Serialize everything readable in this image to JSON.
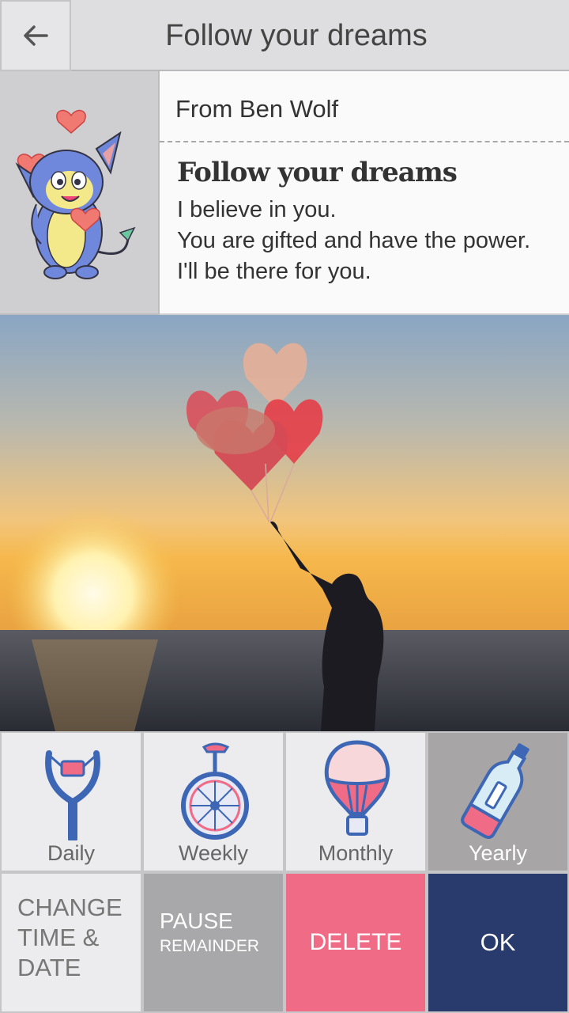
{
  "header": {
    "title": "Follow your dreams"
  },
  "message": {
    "from": "From  Ben Wolf",
    "title": "Follow your dreams",
    "body": "I believe in you.\nYou are gifted and have the power. I'll be there for you."
  },
  "frequency": [
    {
      "label": "Daily",
      "icon": "slingshot-icon"
    },
    {
      "label": "Weekly",
      "icon": "unicycle-icon"
    },
    {
      "label": "Monthly",
      "icon": "hot-air-balloon-icon"
    },
    {
      "label": "Yearly",
      "icon": "message-bottle-icon",
      "selected": true
    }
  ],
  "actions": {
    "change": "CHANGE\nTIME &\nDATE",
    "pause_line1": "PAUSE",
    "pause_line2": "REMAINDER",
    "delete": "DELETE",
    "ok": "OK"
  },
  "colors": {
    "delete": "#f06b86",
    "ok": "#283b6c",
    "selected": "#a7a5a6"
  }
}
